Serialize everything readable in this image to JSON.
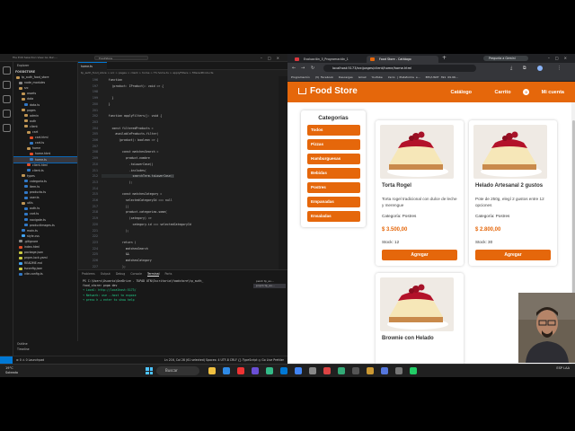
{
  "vscode": {
    "window_title": "FoodStore",
    "menu": "File Edit Selection View Go Run ...",
    "explorer_title": "Explorer",
    "root": "FOODSTORE",
    "tree": [
      {
        "label": "tp_auth_food_store",
        "color": "#c09553"
      },
      {
        "label": "node_modules",
        "color": "#888"
      },
      {
        "label": "src",
        "color": "#c09553"
      },
      {
        "label": "assets",
        "color": "#c09553"
      },
      {
        "label": "data",
        "color": "#c09553"
      },
      {
        "label": "data.ts",
        "color": "#3178c6"
      },
      {
        "label": "pages",
        "color": "#c09553"
      },
      {
        "label": "admin",
        "color": "#c09553"
      },
      {
        "label": "auth",
        "color": "#c09553"
      },
      {
        "label": "client",
        "color": "#c09553"
      },
      {
        "label": "cart",
        "color": "#c09553"
      },
      {
        "label": "cart.html",
        "color": "#e44d26"
      },
      {
        "label": "cart.ts",
        "color": "#3178c6"
      },
      {
        "label": "home",
        "color": "#c09553"
      },
      {
        "label": "home.html",
        "color": "#e44d26"
      },
      {
        "label": "home.ts",
        "color": "#3178c6"
      },
      {
        "label": "client.html",
        "color": "#e44d26"
      },
      {
        "label": "client.ts",
        "color": "#3178c6"
      },
      {
        "label": "types",
        "color": "#c09553"
      },
      {
        "label": "categoria.ts",
        "color": "#3178c6"
      },
      {
        "label": "item.ts",
        "color": "#3178c6"
      },
      {
        "label": "producto.ts",
        "color": "#3178c6"
      },
      {
        "label": "user.ts",
        "color": "#3178c6"
      },
      {
        "label": "utils",
        "color": "#c09553"
      },
      {
        "label": "auth.ts",
        "color": "#3178c6"
      },
      {
        "label": "cart.ts",
        "color": "#3178c6"
      },
      {
        "label": "navigate.ts",
        "color": "#3178c6"
      },
      {
        "label": "productImages.ts",
        "color": "#3178c6"
      },
      {
        "label": "main.ts",
        "color": "#3178c6"
      },
      {
        "label": "style.css",
        "color": "#42a5f5"
      },
      {
        "label": ".gitignore",
        "color": "#888"
      },
      {
        "label": "index.html",
        "color": "#e44d26"
      },
      {
        "label": "package.json",
        "color": "#cbcb41"
      },
      {
        "label": "pnpm-lock.yaml",
        "color": "#cbcb41"
      },
      {
        "label": "README.md",
        "color": "#42a5f5"
      },
      {
        "label": "tsconfig.json",
        "color": "#cbcb41"
      },
      {
        "label": "vite.config.ts",
        "color": "#3178c6"
      }
    ],
    "outline": "Outline",
    "timeline": "Timeline",
    "tab": "home.ts",
    "breadcrumb": "tp_auth_food_store > src > pages > client > home > TS home.ts > applyFilters > filteredProducts",
    "code_lines": [
      {
        "n": "196",
        "t": "    function"
      },
      {
        "n": "197",
        "t": "      (product: IProduct): void => {"
      },
      {
        "n": "198",
        "t": ""
      },
      {
        "n": "199",
        "t": "      }"
      },
      {
        "n": "200",
        "t": "    }"
      },
      {
        "n": "201",
        "t": ""
      },
      {
        "n": "202",
        "t": "    function applyFilters(): void {"
      },
      {
        "n": "203",
        "t": ""
      },
      {
        "n": "204",
        "t": "      const filteredProducts ="
      },
      {
        "n": "205",
        "t": "        availableProducts.filter("
      },
      {
        "n": "206",
        "t": "          (product): boolean => {"
      },
      {
        "n": "207",
        "t": ""
      },
      {
        "n": "208",
        "t": "            const matchesSearch ="
      },
      {
        "n": "209",
        "t": "              product.nombre"
      },
      {
        "n": "210",
        "t": "                .toLowerCase()"
      },
      {
        "n": "211",
        "t": "                .includes("
      },
      {
        "n": "212",
        "t": "                  searchTerm.toLowerCase()"
      },
      {
        "n": "213",
        "t": "                );"
      },
      {
        "n": "214",
        "t": ""
      },
      {
        "n": "215",
        "t": "            const matchesCategory ="
      },
      {
        "n": "216",
        "t": "              selectedCategoryId === null"
      },
      {
        "n": "217",
        "t": "              ||"
      },
      {
        "n": "218",
        "t": "              product.categorias.some("
      },
      {
        "n": "219",
        "t": "                (category) =>"
      },
      {
        "n": "220",
        "t": "                  category.id === selectedCategoryId"
      },
      {
        "n": "221",
        "t": "              );"
      },
      {
        "n": "222",
        "t": ""
      },
      {
        "n": "223",
        "t": "            return ("
      },
      {
        "n": "224",
        "t": "              matchesSearch"
      },
      {
        "n": "225",
        "t": "              &&"
      },
      {
        "n": "226",
        "t": "              matchesCategory"
      },
      {
        "n": "227",
        "t": "            );"
      },
      {
        "n": "228",
        "t": "          }"
      },
      {
        "n": "229",
        "t": "        );"
      }
    ],
    "panel_tabs": [
      "Problems",
      "Output",
      "Debug Console",
      "Terminal",
      "Ports"
    ],
    "terminal": [
      "PS C:\\Users\\Usuario\\OneDrive - TUPAD UTN\\Escritorio\\foodstore\\tp_auth_",
      "food_store> pnpm dev",
      "  ➜  Local:   http://localhost:5173/",
      "  ➜  Network: use --host to expose",
      "  ➜  press h + enter to show help"
    ],
    "terminals": [
      "pwsh tp_au...",
      "pnpm tp_au..."
    ],
    "status_left": "⊗ 0 ⚠ 0   Launchpad",
    "status_right": "Ln 216, Col 28 (61 selected)   Spaces: 4   UTF-8   CRLF   {} TypeScript   ◎ Go Live   Prettier"
  },
  "browser": {
    "tabs": [
      {
        "label": "Evaluación_5_Programación_1",
        "active": false,
        "fav": "#d9373e"
      },
      {
        "label": "Food Store - Catálogo",
        "active": true,
        "fav": "#e5670b"
      }
    ],
    "gemini": "Pregunta a Gemini",
    "url": "localhost:5173/src/pages/client/home/home.html",
    "bookmarks": [
      "Programación",
      "(3) Facebook",
      "Descargas",
      "Gmail",
      "YouTube",
      "Inicio | Plataforma e...",
      "BTC/USDT 391 09.96..."
    ]
  },
  "site": {
    "brand": "Food Store",
    "nav": {
      "catalog": "Catálogo",
      "cart": "Carrito",
      "cart_count": "0",
      "account": "Mi cuenta"
    },
    "categories_title": "Categorías",
    "categories": [
      "Todos",
      "Pizzas",
      "Hamburguesas",
      "Bebidas",
      "Postres",
      "Empanadas",
      "Ensaladas"
    ],
    "products": [
      {
        "name": "Torta Rogel",
        "desc": "Torta rogel tradicional con dulce de leche y merengue",
        "category": "Categoría: Postres",
        "price": "$ 3.500,00",
        "stock": "Stock: 12",
        "button": "Agregar"
      },
      {
        "name": "Helado Artesanal 2 gustos",
        "desc": "Pote de 250g, elegí 2 gustos entre 12 opciones",
        "category": "Categoría: Postres",
        "price": "$ 2.800,00",
        "stock": "Stock: 30",
        "button": "Agregar"
      },
      {
        "name": "Brownie con Helado",
        "desc": "",
        "category": "",
        "price": "",
        "stock": "",
        "button": ""
      }
    ]
  },
  "taskbar": {
    "weather_temp": "19°C",
    "weather_desc": "Soleado",
    "search": "Buscar",
    "lang": "ESP LAA"
  }
}
